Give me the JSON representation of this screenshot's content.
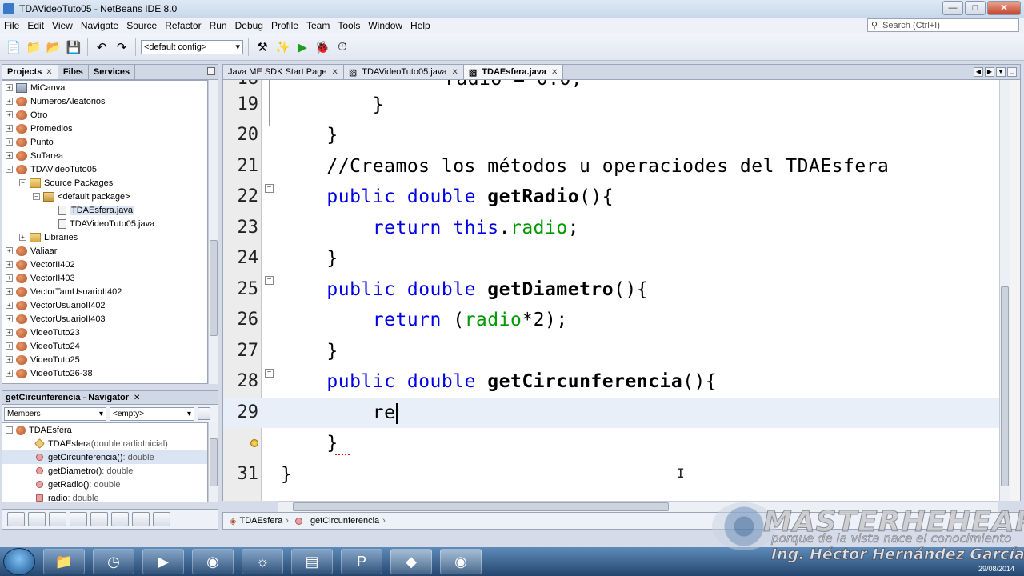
{
  "window": {
    "title": "TDAVideoTuto05 - NetBeans IDE 8.0",
    "minimize": "—",
    "maximize": "□",
    "close": "✕"
  },
  "menu": [
    "File",
    "Edit",
    "View",
    "Navigate",
    "Source",
    "Refactor",
    "Run",
    "Debug",
    "Profile",
    "Team",
    "Tools",
    "Window",
    "Help"
  ],
  "search": {
    "placeholder": "Search (Ctrl+I)"
  },
  "toolbar": {
    "config": "<default config>"
  },
  "projects_panel": {
    "tabs": [
      "Projects",
      "Files",
      "Services"
    ],
    "items": [
      {
        "label": "MiCanva",
        "type": "project"
      },
      {
        "label": "NumerosAleatorios",
        "type": "project"
      },
      {
        "label": "Otro",
        "type": "project"
      },
      {
        "label": "Promedios",
        "type": "project"
      },
      {
        "label": "Punto",
        "type": "project"
      },
      {
        "label": "SuTarea",
        "type": "project"
      },
      {
        "label": "TDAVideoTuto05",
        "type": "project"
      },
      {
        "label": "Source Packages",
        "type": "folder"
      },
      {
        "label": "<default package>",
        "type": "package"
      },
      {
        "label": "TDAEsfera.java",
        "type": "file"
      },
      {
        "label": "TDAVideoTuto05.java",
        "type": "file"
      },
      {
        "label": "Libraries",
        "type": "library"
      },
      {
        "label": "Valiaar",
        "type": "project"
      },
      {
        "label": "VectorII402",
        "type": "project"
      },
      {
        "label": "VectorII403",
        "type": "project"
      },
      {
        "label": "VectorTamUsuarioII402",
        "type": "project"
      },
      {
        "label": "VectorUsuarioII402",
        "type": "project"
      },
      {
        "label": "VectorUsuarioII403",
        "type": "project"
      },
      {
        "label": "VideoTuto23",
        "type": "project"
      },
      {
        "label": "VideoTuto24",
        "type": "project"
      },
      {
        "label": "VideoTuto25",
        "type": "project"
      },
      {
        "label": "VideoTuto26-38",
        "type": "project"
      }
    ]
  },
  "navigator": {
    "title": "getCircunferencia - Navigator",
    "filter": "Members",
    "empty": "<empty>",
    "class_name": "TDAEsfera",
    "members": [
      {
        "name": "TDAEsfera",
        "suffix": "(double radioInicial)",
        "kind": "ctor"
      },
      {
        "name": "getCircunferencia()",
        "suffix": " : double",
        "kind": "method"
      },
      {
        "name": "getDiametro()",
        "suffix": " : double",
        "kind": "method"
      },
      {
        "name": "getRadio()",
        "suffix": " : double",
        "kind": "method"
      },
      {
        "name": "radio",
        "suffix": " : double",
        "kind": "field"
      }
    ]
  },
  "editor_tabs": [
    {
      "label": "Java ME SDK Start Page",
      "active": false
    },
    {
      "label": "TDAVideoTuto05.java",
      "active": false
    },
    {
      "label": "TDAEsfera.java",
      "active": true
    }
  ],
  "code": {
    "lines": [
      {
        "n": "19",
        "text": "        }"
      },
      {
        "n": "20",
        "text": "    }"
      },
      {
        "n": "21",
        "text": "    //Creamos los métodos u operaciodes del TDAEsfera"
      },
      {
        "n": "22",
        "text": "    public double getRadio(){"
      },
      {
        "n": "23",
        "text": "        return this.radio;"
      },
      {
        "n": "24",
        "text": "    }"
      },
      {
        "n": "25",
        "text": "    public double getDiametro(){"
      },
      {
        "n": "26",
        "text": "        return (radio*2);"
      },
      {
        "n": "27",
        "text": "    }"
      },
      {
        "n": "28",
        "text": "    public double getCircunferencia(){"
      },
      {
        "n": "29",
        "text": "        re"
      },
      {
        "n": "",
        "text": "    }"
      },
      {
        "n": "31",
        "text": "}"
      }
    ]
  },
  "breadcrumb": [
    "TDAEsfera",
    "getCircunferencia"
  ],
  "watermark": {
    "title": "MASTERHEHEAR",
    "subtitle": "porque de la vista nace el conocimiento",
    "author": "Ing. Héctor Hernández García",
    "date": "29/08/2014"
  }
}
